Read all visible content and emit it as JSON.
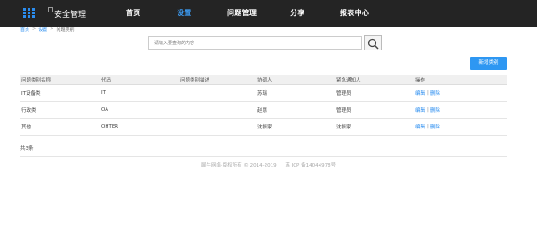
{
  "header": {
    "logo_text": "安全管理",
    "nav": [
      {
        "label": "首页",
        "active": false
      },
      {
        "label": "设置",
        "active": true
      },
      {
        "label": "问题管理",
        "active": false
      },
      {
        "label": "分享",
        "active": false
      },
      {
        "label": "报表中心",
        "active": false
      }
    ],
    "accent_color": "#3c9bf2"
  },
  "breadcrumb": {
    "items": [
      "首页",
      "设置",
      "问题类别"
    ],
    "separator": ">"
  },
  "search": {
    "placeholder": "请输入要查询的内容",
    "value": ""
  },
  "toolbar": {
    "add_label": "新增类别"
  },
  "table": {
    "columns": [
      "问题类别名称",
      "代码",
      "问题类别描述",
      "协调人",
      "紧急通知人",
      "操作"
    ],
    "rows": [
      {
        "name": "IT设备类",
        "code": "IT",
        "desc": "",
        "coordinator": "苏瑞",
        "contact": "管理员",
        "edit": "编辑",
        "delete": "删除"
      },
      {
        "name": "行政类",
        "code": "OA",
        "desc": "",
        "coordinator": "赵惠",
        "contact": "管理员",
        "edit": "编辑",
        "delete": "删除"
      },
      {
        "name": "其他",
        "code": "OHTER",
        "desc": "",
        "coordinator": "沈振家",
        "contact": "沈振家",
        "edit": "编辑",
        "delete": "删除"
      }
    ],
    "op_separator": "|"
  },
  "total_text": "共3条",
  "footer": {
    "copyright": "犀牛网络·版权所有 © 2014-2019",
    "icp": "苏 ICP 备14044978号"
  }
}
